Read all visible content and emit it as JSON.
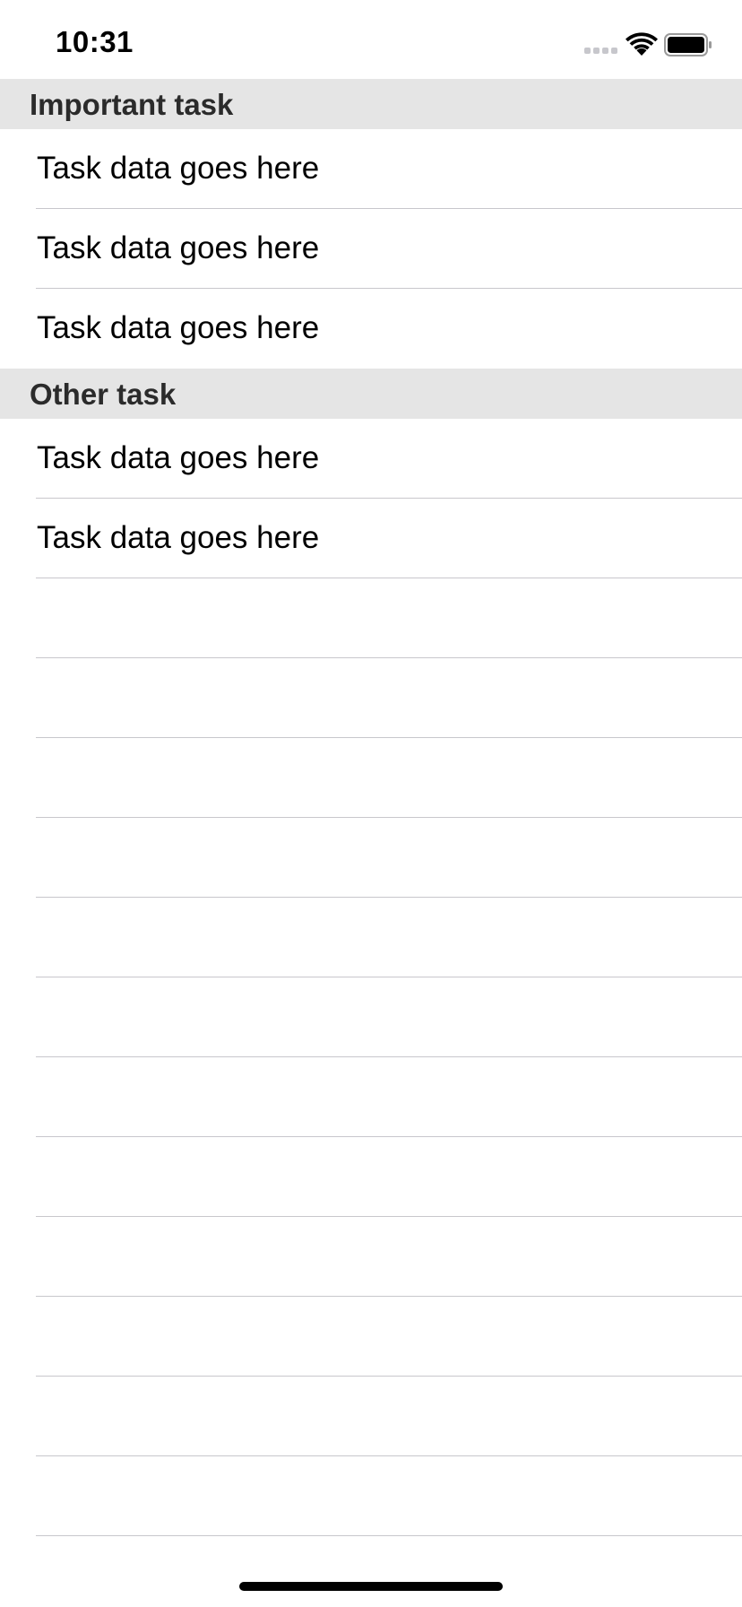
{
  "status_bar": {
    "time": "10:31",
    "signal_icon": "cellular-signal-icon",
    "wifi_icon": "wifi-icon",
    "battery_icon": "battery-icon"
  },
  "sections": [
    {
      "title": "Important task",
      "rows": [
        "Task data goes here",
        "Task data goes here",
        "Task data goes here"
      ]
    },
    {
      "title": "Other task",
      "rows": [
        "Task data goes here",
        "Task data goes here"
      ]
    }
  ],
  "colors": {
    "section_header_bg": "#e5e5e5",
    "separator": "#c8c7cc",
    "background": "#ffffff"
  }
}
